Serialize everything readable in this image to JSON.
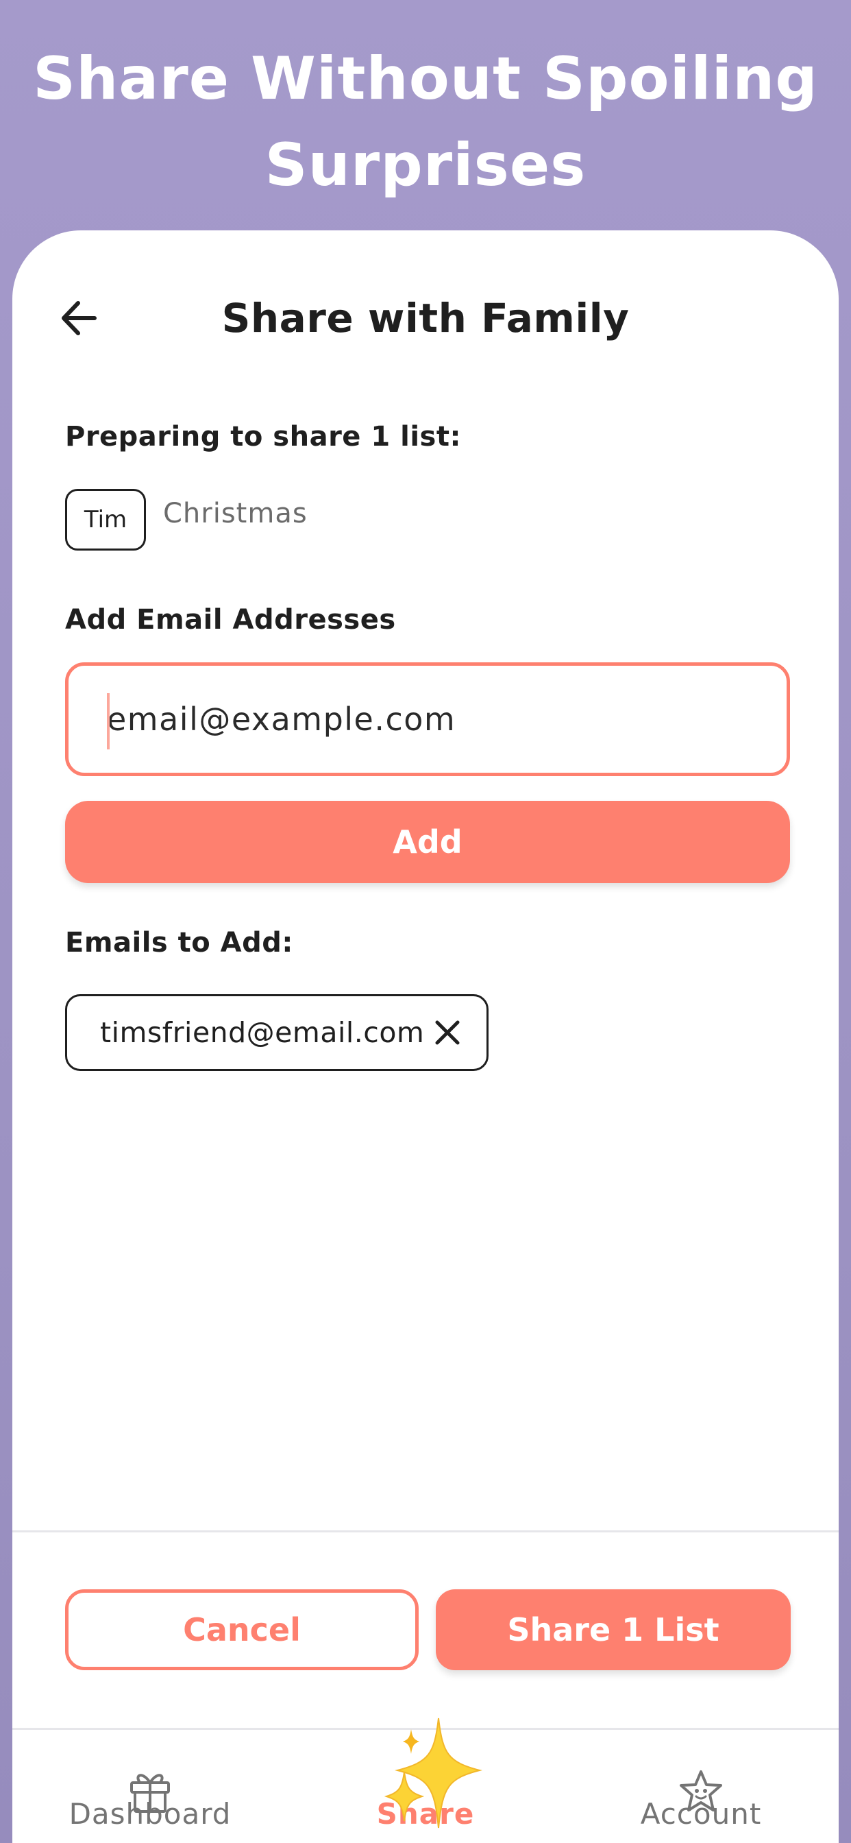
{
  "headline": {
    "line1": "Share Without Spoiling",
    "line2": "Surprises"
  },
  "header": {
    "title": "Share with Family",
    "back_icon": "arrow-left-icon"
  },
  "preparing": {
    "label": "Preparing to share 1 list:",
    "owner": "Tim",
    "list_name": "Christmas"
  },
  "add_email": {
    "label": "Add Email Addresses",
    "input_value": "email@example.com",
    "button_label": "Add"
  },
  "emails": {
    "label": "Emails to Add:",
    "items": [
      "timsfriend@email.com"
    ]
  },
  "actions": {
    "cancel_label": "Cancel",
    "share_label": "Share 1 List"
  },
  "tabs": [
    {
      "label": "Dashboard",
      "icon": "gift-icon",
      "active": false
    },
    {
      "label": "Share",
      "icon": "sparkles-icon",
      "active": true
    },
    {
      "label": "Account",
      "icon": "star-face-icon",
      "active": false
    }
  ],
  "colors": {
    "accent": "#fe806f",
    "background": "#a59acb",
    "text": "#1f1f1f",
    "inactive": "#747474"
  }
}
